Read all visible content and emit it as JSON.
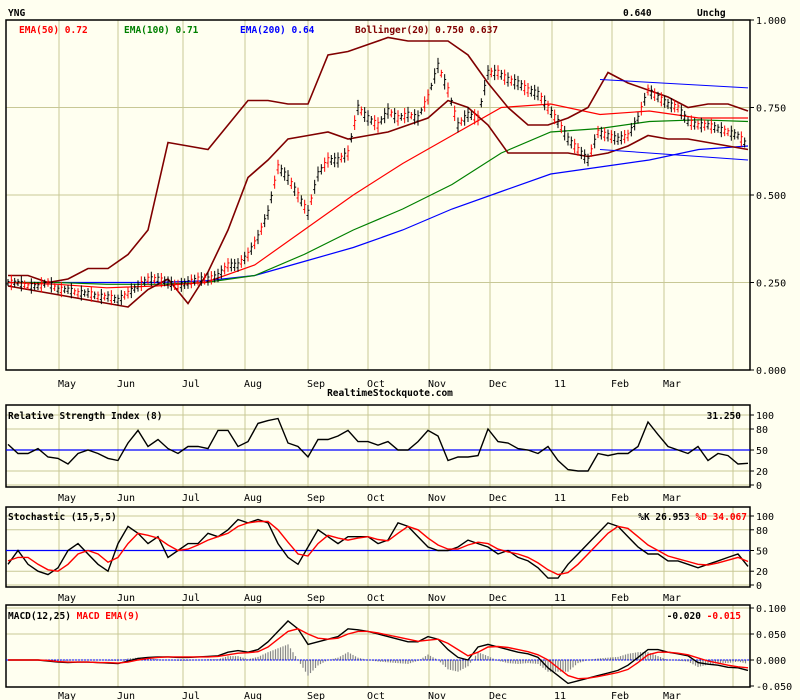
{
  "header": {
    "symbol": "YNG",
    "last": "0.640",
    "change": "Unchg",
    "source": "RealtimeStockquote.com"
  },
  "colors": {
    "background": "#fffff0",
    "grid": "#c8c896",
    "ema50": "#ff0000",
    "ema100": "#008000",
    "ema200": "#0000ff",
    "bollinger": "#800000",
    "price": "#000000",
    "histogram": "#888888"
  },
  "months": [
    "May",
    "Jun",
    "Jul",
    "Aug",
    "Sep",
    "Oct",
    "Nov",
    "Dec",
    "11",
    "Feb",
    "Mar"
  ],
  "chart_data": [
    {
      "type": "line",
      "name": "price",
      "title": "YNG",
      "legend": {
        "ema50": {
          "label": "EMA(50)",
          "value": "0.72"
        },
        "ema100": {
          "label": "EMA(100)",
          "value": "0.71"
        },
        "ema200": {
          "label": "EMA(200)",
          "value": "0.64"
        },
        "bollinger": {
          "label": "Bollinger(20)",
          "upper": "0.750",
          "lower": "0.637"
        }
      },
      "yticks": [
        "1.000",
        "0.750",
        "0.500",
        "0.250",
        "0.000"
      ],
      "ylim": [
        0,
        1
      ],
      "close": [
        0.25,
        0.25,
        0.24,
        0.24,
        0.25,
        0.23,
        0.23,
        0.22,
        0.22,
        0.21,
        0.21,
        0.2,
        0.22,
        0.24,
        0.26,
        0.26,
        0.25,
        0.24,
        0.25,
        0.26,
        0.26,
        0.27,
        0.3,
        0.3,
        0.33,
        0.38,
        0.45,
        0.58,
        0.55,
        0.5,
        0.45,
        0.56,
        0.6,
        0.6,
        0.62,
        0.75,
        0.72,
        0.7,
        0.74,
        0.72,
        0.73,
        0.72,
        0.78,
        0.87,
        0.8,
        0.7,
        0.73,
        0.72,
        0.85,
        0.85,
        0.83,
        0.82,
        0.8,
        0.79,
        0.75,
        0.71,
        0.66,
        0.63,
        0.6,
        0.68,
        0.67,
        0.66,
        0.67,
        0.72,
        0.8,
        0.78,
        0.76,
        0.75,
        0.71,
        0.7,
        0.7,
        0.69,
        0.68,
        0.67,
        0.64
      ],
      "ema50": [
        0.25,
        0.245,
        0.235,
        0.24,
        0.25,
        0.3,
        0.4,
        0.5,
        0.59,
        0.67,
        0.75,
        0.76,
        0.73,
        0.74,
        0.72,
        0.72
      ],
      "ema100": [
        0.25,
        0.25,
        0.245,
        0.245,
        0.25,
        0.27,
        0.33,
        0.4,
        0.46,
        0.53,
        0.62,
        0.68,
        0.69,
        0.71,
        0.715,
        0.71
      ],
      "ema200": [
        0.25,
        0.25,
        0.25,
        0.25,
        0.255,
        0.27,
        0.31,
        0.35,
        0.4,
        0.46,
        0.51,
        0.56,
        0.58,
        0.6,
        0.63,
        0.64
      ],
      "bollinger_upper": [
        0.27,
        0.27,
        0.25,
        0.26,
        0.29,
        0.29,
        0.33,
        0.4,
        0.65,
        0.64,
        0.63,
        0.7,
        0.77,
        0.77,
        0.76,
        0.76,
        0.9,
        0.91,
        0.93,
        0.95,
        0.94,
        0.94,
        0.94,
        0.9,
        0.82,
        0.75,
        0.7,
        0.7,
        0.72,
        0.75,
        0.85,
        0.82,
        0.8,
        0.78,
        0.75,
        0.76,
        0.76,
        0.74
      ],
      "bollinger_lower": [
        0.24,
        0.23,
        0.22,
        0.21,
        0.2,
        0.19,
        0.18,
        0.23,
        0.26,
        0.19,
        0.28,
        0.4,
        0.55,
        0.6,
        0.66,
        0.67,
        0.68,
        0.66,
        0.67,
        0.68,
        0.7,
        0.72,
        0.77,
        0.75,
        0.7,
        0.62,
        0.62,
        0.62,
        0.62,
        0.61,
        0.62,
        0.64,
        0.67,
        0.66,
        0.66,
        0.65,
        0.64,
        0.63
      ],
      "trend_upper": [
        0.83,
        0.806
      ],
      "trend_lower": [
        0.63,
        0.6
      ]
    },
    {
      "type": "line",
      "name": "rsi",
      "title": "Relative Strength Index (8)",
      "value": "31.250",
      "yticks": [
        "100",
        "80",
        "50",
        "20",
        "0"
      ],
      "ylim": [
        0,
        100
      ],
      "reference": 50,
      "values": [
        58,
        45,
        45,
        52,
        40,
        38,
        30,
        45,
        50,
        45,
        38,
        35,
        60,
        78,
        55,
        65,
        52,
        45,
        55,
        55,
        52,
        78,
        78,
        55,
        62,
        88,
        92,
        95,
        60,
        55,
        40,
        65,
        65,
        70,
        78,
        62,
        62,
        57,
        62,
        50,
        50,
        62,
        78,
        70,
        35,
        40,
        40,
        42,
        80,
        62,
        60,
        52,
        50,
        45,
        55,
        35,
        22,
        20,
        20,
        45,
        42,
        45,
        45,
        55,
        90,
        72,
        55,
        50,
        45,
        55,
        35,
        45,
        42,
        30,
        31
      ]
    },
    {
      "type": "line",
      "name": "stochastic",
      "title": "Stochastic (15,5,5)",
      "k_label": "%K",
      "k_value": "26.953",
      "d_label": "%D",
      "d_value": "34.067",
      "yticks": [
        "100",
        "80",
        "50",
        "20",
        "0"
      ],
      "ylim": [
        0,
        100
      ],
      "reference": 50,
      "k": [
        30,
        50,
        30,
        20,
        15,
        25,
        50,
        60,
        45,
        30,
        20,
        60,
        85,
        75,
        60,
        70,
        40,
        50,
        60,
        60,
        75,
        70,
        80,
        95,
        90,
        95,
        90,
        60,
        40,
        30,
        55,
        80,
        70,
        60,
        70,
        70,
        70,
        60,
        65,
        90,
        85,
        70,
        55,
        50,
        50,
        55,
        65,
        60,
        55,
        45,
        50,
        40,
        35,
        25,
        10,
        10,
        30,
        45,
        60,
        75,
        90,
        85,
        70,
        55,
        45,
        45,
        35,
        35,
        30,
        25,
        30,
        35,
        40,
        45,
        27
      ],
      "d": [
        35,
        40,
        40,
        30,
        22,
        20,
        30,
        45,
        50,
        45,
        33,
        40,
        60,
        75,
        72,
        68,
        58,
        50,
        52,
        58,
        65,
        70,
        75,
        85,
        90,
        92,
        92,
        80,
        62,
        45,
        42,
        60,
        72,
        68,
        65,
        68,
        70,
        66,
        64,
        75,
        85,
        80,
        68,
        58,
        52,
        52,
        58,
        62,
        60,
        52,
        48,
        45,
        40,
        32,
        22,
        15,
        18,
        30,
        45,
        60,
        75,
        85,
        82,
        70,
        58,
        50,
        42,
        38,
        34,
        30,
        29,
        32,
        36,
        40,
        34
      ]
    },
    {
      "type": "line",
      "name": "macd",
      "title": "MACD(12,25)",
      "signal_title": "MACD EMA(9)",
      "macd_value": "-0.020",
      "signal_value": "-0.015",
      "yticks": [
        "0.100",
        "0.050",
        "0.000",
        "-0.050"
      ],
      "ylim": [
        -0.05,
        0.1
      ],
      "reference": 0,
      "macd": [
        0,
        0,
        0,
        0,
        -0.002,
        -0.004,
        -0.005,
        -0.004,
        -0.004,
        -0.005,
        -0.006,
        -0.007,
        -0.002,
        0.003,
        0.005,
        0.006,
        0.006,
        0.005,
        0.005,
        0.006,
        0.007,
        0.008,
        0.015,
        0.018,
        0.015,
        0.02,
        0.035,
        0.055,
        0.075,
        0.06,
        0.03,
        0.035,
        0.04,
        0.045,
        0.06,
        0.058,
        0.055,
        0.05,
        0.045,
        0.04,
        0.035,
        0.035,
        0.045,
        0.04,
        0.02,
        0.005,
        0.0,
        0.025,
        0.03,
        0.025,
        0.02,
        0.015,
        0.012,
        0.005,
        -0.015,
        -0.03,
        -0.045,
        -0.04,
        -0.035,
        -0.03,
        -0.025,
        -0.02,
        -0.01,
        0.005,
        0.02,
        0.02,
        0.015,
        0.012,
        0.008,
        -0.005,
        -0.008,
        -0.01,
        -0.014,
        -0.015,
        -0.02
      ],
      "signal": [
        0,
        0,
        0,
        0,
        -0.001,
        -0.003,
        -0.004,
        -0.004,
        -0.004,
        -0.005,
        -0.005,
        -0.006,
        -0.004,
        0.0,
        0.003,
        0.005,
        0.006,
        0.006,
        0.006,
        0.006,
        0.006,
        0.007,
        0.01,
        0.013,
        0.014,
        0.016,
        0.025,
        0.04,
        0.055,
        0.06,
        0.05,
        0.042,
        0.04,
        0.042,
        0.05,
        0.055,
        0.055,
        0.052,
        0.048,
        0.044,
        0.04,
        0.036,
        0.038,
        0.04,
        0.032,
        0.02,
        0.008,
        0.015,
        0.025,
        0.026,
        0.024,
        0.02,
        0.016,
        0.01,
        0.0,
        -0.015,
        -0.03,
        -0.036,
        -0.035,
        -0.032,
        -0.028,
        -0.024,
        -0.018,
        -0.005,
        0.01,
        0.015,
        0.015,
        0.013,
        0.01,
        0.004,
        -0.002,
        -0.006,
        -0.01,
        -0.013,
        -0.015
      ]
    }
  ]
}
